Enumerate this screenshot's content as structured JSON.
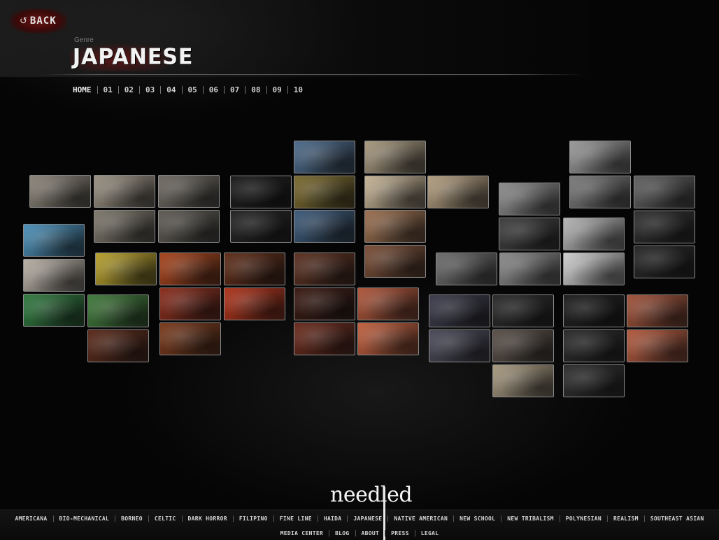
{
  "header": {
    "back_label": "BACK",
    "back_icon": "return-arrow-icon",
    "genre_caption": "Genre",
    "genre_title": "JAPANESE",
    "page_nav": [
      "HOME",
      "01",
      "02",
      "03",
      "04",
      "05",
      "06",
      "07",
      "08",
      "09",
      "10"
    ]
  },
  "mosaic": {
    "tiles": [
      {
        "name": "skull-thumbnail",
        "tone": "#8b8478"
      },
      {
        "name": "skull-thumbnail",
        "tone": "#9a9182"
      },
      {
        "name": "skull-thumbnail",
        "tone": "#6f6a62"
      },
      {
        "name": "skull-thumbnail",
        "tone": "#7e786c"
      },
      {
        "name": "skull-thumbnail",
        "tone": "#5f5b54"
      },
      {
        "name": "kanji-calligraphy-thumbnail",
        "tone": "#1b1b1b"
      },
      {
        "name": "kanji-calligraphy-thumbnail",
        "tone": "#232323"
      },
      {
        "name": "koi-fish-thumbnail",
        "tone": "#4c6a8a"
      },
      {
        "name": "koi-fish-thumbnail",
        "tone": "#7a6a2f"
      },
      {
        "name": "koi-fish-thumbnail",
        "tone": "#3c5a7a"
      },
      {
        "name": "back-tattoo-sepia-thumbnail",
        "tone": "#a8997f"
      },
      {
        "name": "back-tattoo-sepia-thumbnail",
        "tone": "#c7b597"
      },
      {
        "name": "back-tattoo-sepia-thumbnail",
        "tone": "#b49f80"
      },
      {
        "name": "back-tattoo-sepia-thumbnail",
        "tone": "#9b6f4f"
      },
      {
        "name": "back-tattoo-sepia-thumbnail",
        "tone": "#7a4e37"
      },
      {
        "name": "tattoo-artist-bw-thumbnail",
        "tone": "#9a9a9a"
      },
      {
        "name": "tattoo-artist-bw-thumbnail",
        "tone": "#7a7a7a"
      },
      {
        "name": "tattoo-artist-bw-thumbnail",
        "tone": "#5f5f5f"
      },
      {
        "name": "tattoo-artist-bw-thumbnail",
        "tone": "#8c8c8c"
      },
      {
        "name": "tattoo-artist-bw-thumbnail",
        "tone": "#3f3f3f"
      },
      {
        "name": "tattoo-artist-bw-thumbnail",
        "tone": "#b5b5b5"
      },
      {
        "name": "tattoo-artist-bw-thumbnail",
        "tone": "#2e2e2e"
      },
      {
        "name": "tattoo-artist-bw-thumbnail",
        "tone": "#6c6c6c"
      },
      {
        "name": "kabuki-mask-thumbnail",
        "tone": "#4a8fb8"
      },
      {
        "name": "kabuki-mask-thumbnail",
        "tone": "#b8b0a5"
      },
      {
        "name": "kabuki-mask-thumbnail",
        "tone": "#2f7a3f"
      },
      {
        "name": "warrior-painting-thumbnail",
        "tone": "#b8a12c"
      },
      {
        "name": "warrior-painting-thumbnail",
        "tone": "#a8441c"
      },
      {
        "name": "warrior-painting-thumbnail",
        "tone": "#5e2c18"
      },
      {
        "name": "warrior-painting-thumbnail",
        "tone": "#3f7a3a"
      },
      {
        "name": "warrior-painting-thumbnail",
        "tone": "#8a2d1c"
      },
      {
        "name": "warrior-painting-thumbnail",
        "tone": "#b0331a"
      },
      {
        "name": "warrior-painting-thumbnail",
        "tone": "#5a2a1a"
      },
      {
        "name": "warrior-painting-thumbnail",
        "tone": "#7a3a1c"
      },
      {
        "name": "sleeve-tattoo-thumbnail",
        "tone": "#5a3020"
      },
      {
        "name": "sleeve-tattoo-thumbnail",
        "tone": "#3a1a12"
      },
      {
        "name": "sleeve-tattoo-thumbnail",
        "tone": "#b0563a"
      },
      {
        "name": "sleeve-tattoo-thumbnail",
        "tone": "#6a2a1c"
      },
      {
        "name": "sleeve-tattoo-thumbnail",
        "tone": "#c2603e"
      },
      {
        "name": "tattooing-session-thumbnail",
        "tone": "#3a3a4a"
      },
      {
        "name": "tattooing-session-thumbnail",
        "tone": "#4a4a5a"
      },
      {
        "name": "tattooing-session-thumbnail",
        "tone": "#2a2a2a"
      },
      {
        "name": "tattooing-session-thumbnail",
        "tone": "#5a5048"
      },
      {
        "name": "tattooing-session-thumbnail",
        "tone": "#a89a80"
      },
      {
        "name": "gloved-hands-tattoo-thumbnail",
        "tone": "#1e1e1e"
      },
      {
        "name": "gloved-hands-tattoo-thumbnail",
        "tone": "#a0523a"
      },
      {
        "name": "gloved-hands-tattoo-thumbnail",
        "tone": "#2a2a2a"
      },
      {
        "name": "gloved-hands-tattoo-thumbnail",
        "tone": "#b35a3e"
      },
      {
        "name": "gloved-hands-tattoo-thumbnail",
        "tone": "#2e2e2e"
      }
    ]
  },
  "footer": {
    "logo_left": "need",
    "logo_right": "led",
    "genres": [
      "AMERICANA",
      "BIO-MECHANICAL",
      "BORNEO",
      "CELTIC",
      "DARK HORROR",
      "FILIPINO",
      "FINE LINE",
      "HAIDA",
      "JAPANESE",
      "NATIVE AMERICAN",
      "NEW SCHOOL",
      "NEW TRIBALISM",
      "POLYNESIAN",
      "REALISM",
      "SOUTHEAST ASIAN"
    ],
    "meta_links": [
      "MEDIA CENTER",
      "BLOG",
      "ABOUT",
      "PRESS",
      "LEGAL"
    ]
  },
  "colors": {
    "background": "#050505",
    "text_light": "#e6e6e6",
    "accent_red": "#6a1414",
    "tile_border": "#8a8a8a"
  }
}
